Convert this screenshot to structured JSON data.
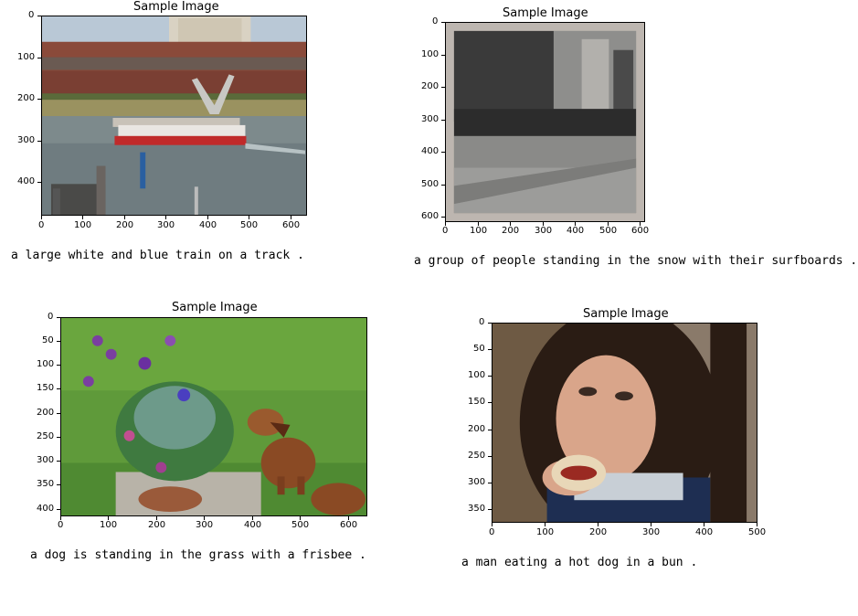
{
  "panels": [
    {
      "title": "Sample Image",
      "caption": "a large white and blue train on a track .",
      "yticks": [
        "0",
        "100",
        "200",
        "300",
        "400"
      ],
      "xticks": [
        "0",
        "100",
        "200",
        "300",
        "400",
        "500",
        "600"
      ]
    },
    {
      "title": "Sample Image",
      "caption": "a group of people standing in the snow with their surfboards .",
      "yticks": [
        "0",
        "100",
        "200",
        "300",
        "400",
        "500",
        "600"
      ],
      "xticks": [
        "0",
        "100",
        "200",
        "300",
        "400",
        "500",
        "600"
      ]
    },
    {
      "title": "Sample Image",
      "caption": "a dog is standing in the grass with a frisbee .",
      "yticks": [
        "0",
        "50",
        "100",
        "150",
        "200",
        "250",
        "300",
        "350",
        "400"
      ],
      "xticks": [
        "0",
        "100",
        "200",
        "300",
        "400",
        "500",
        "600"
      ]
    },
    {
      "title": "Sample Image",
      "caption": "a man eating a hot dog in a bun .",
      "yticks": [
        "0",
        "50",
        "100",
        "150",
        "200",
        "250",
        "300",
        "350"
      ],
      "xticks": [
        "0",
        "100",
        "200",
        "300",
        "400",
        "500"
      ]
    }
  ]
}
